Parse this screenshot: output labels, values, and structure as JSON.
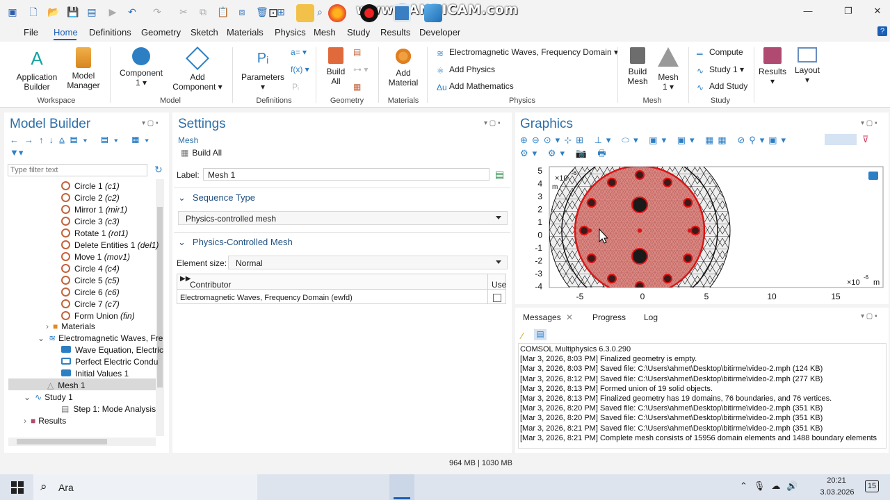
{
  "watermark": "www.BANDICAM.com",
  "menu": {
    "file": "File",
    "home": "Home",
    "definitions": "Definitions",
    "geometry": "Geometry",
    "sketch": "Sketch",
    "materials": "Materials",
    "physics": "Physics",
    "mesh": "Mesh",
    "study": "Study",
    "results": "Results",
    "developer": "Developer"
  },
  "ribbon": {
    "app_builder": [
      "Application",
      "Builder"
    ],
    "model_manager": [
      "Model",
      "Manager"
    ],
    "component": [
      "Component",
      "1 ▾"
    ],
    "add_component": [
      "Add",
      "Component ▾"
    ],
    "parameters": [
      "Parameters",
      "▾"
    ],
    "build_all": [
      "Build",
      "All"
    ],
    "add_material": [
      "Add",
      "Material"
    ],
    "physics_interface": "Electromagnetic Waves, Frequency Domain",
    "add_physics": "Add Physics",
    "add_mathematics": "Add Mathematics",
    "build_mesh": [
      "Build",
      "Mesh"
    ],
    "mesh1": [
      "Mesh",
      "1 ▾"
    ],
    "compute": "Compute",
    "study1": "Study 1",
    "add_study": "Add Study",
    "results": [
      "Results",
      "▾"
    ],
    "layout": [
      "Layout",
      "▾"
    ],
    "groups": {
      "workspace": "Workspace",
      "model": "Model",
      "definitions": "Definitions",
      "geometry": "Geometry",
      "materials": "Materials",
      "physics": "Physics",
      "mesh": "Mesh",
      "study": "Study"
    }
  },
  "model_builder": {
    "title": "Model Builder",
    "filter_placeholder": "Type filter text",
    "items": [
      {
        "label": "Circle 1",
        "tag": "(c1)"
      },
      {
        "label": "Circle 2",
        "tag": "(c2)"
      },
      {
        "label": "Mirror 1",
        "tag": "(mir1)"
      },
      {
        "label": "Circle 3",
        "tag": "(c3)"
      },
      {
        "label": "Rotate 1",
        "tag": "(rot1)"
      },
      {
        "label": "Delete Entities 1",
        "tag": "(del1)"
      },
      {
        "label": "Move 1",
        "tag": "(mov1)"
      },
      {
        "label": "Circle 4",
        "tag": "(c4)"
      },
      {
        "label": "Circle 5",
        "tag": "(c5)"
      },
      {
        "label": "Circle 6",
        "tag": "(c6)"
      },
      {
        "label": "Circle 7",
        "tag": "(c7)"
      },
      {
        "label": "Form Union",
        "tag": "(fin)"
      }
    ],
    "materials": "Materials",
    "emw": "Electromagnetic Waves, Fre",
    "wave_eq": "Wave Equation, Electric",
    "pec": "Perfect Electric Condu",
    "init": "Initial Values 1",
    "mesh1": "Mesh 1",
    "study1": "Study 1",
    "step1": "Step 1: Mode Analysis",
    "results": "Results"
  },
  "settings": {
    "title": "Settings",
    "subtitle": "Mesh",
    "build_all": "Build All",
    "label_caption": "Label:",
    "label_value": "Mesh 1",
    "seq_section": "Sequence Type",
    "seq_value": "Physics-controlled mesh",
    "pcm_section": "Physics-Controlled Mesh",
    "elem_caption": "Element size:",
    "elem_value": "Normal",
    "col_contributor": "Contributor",
    "col_use": "Use",
    "row_contributor": "Electromagnetic Waves, Frequency Domain (ewfd)"
  },
  "graphics": {
    "title": "Graphics",
    "y_ticks": [
      "5",
      "4",
      "3",
      "2",
      "1",
      "0",
      "-1",
      "-2",
      "-3",
      "-4"
    ],
    "x_ticks": [
      "-5",
      "0",
      "5",
      "10",
      "15"
    ],
    "y_exp": "×10",
    "y_exp_pow": "-6",
    "y_unit": "m",
    "x_exp": "×10",
    "x_exp_pow": "-6",
    "x_unit": "m"
  },
  "messages": {
    "tabs": [
      "Messages",
      "Progress",
      "Log"
    ],
    "lines": [
      "COMSOL Multiphysics 6.3.0.290",
      "[Mar 3, 2026, 8:03 PM] Finalized geometry is empty.",
      "[Mar 3, 2026, 8:03 PM] Saved file: C:\\Users\\ahmet\\Desktop\\bitirme\\video-2.mph (124 KB)",
      "[Mar 3, 2026, 8:12 PM] Saved file: C:\\Users\\ahmet\\Desktop\\bitirme\\video-2.mph (277 KB)",
      "[Mar 3, 2026, 8:13 PM] Formed union of 19 solid objects.",
      "[Mar 3, 2026, 8:13 PM] Finalized geometry has 19 domains, 76 boundaries, and 76 vertices.",
      "[Mar 3, 2026, 8:20 PM] Saved file: C:\\Users\\ahmet\\Desktop\\bitirme\\video-2.mph (351 KB)",
      "[Mar 3, 2026, 8:20 PM] Saved file: C:\\Users\\ahmet\\Desktop\\bitirme\\video-2.mph (351 KB)",
      "[Mar 3, 2026, 8:21 PM] Saved file: C:\\Users\\ahmet\\Desktop\\bitirme\\video-2.mph (351 KB)",
      "[Mar 3, 2026, 8:21 PM] Complete mesh consists of 15956 domain elements and 1488 boundary elements"
    ]
  },
  "status": {
    "memory": "964 MB | 1030 MB"
  },
  "taskbar": {
    "search": "Ara",
    "time": "20:21",
    "date": "3.03.2026",
    "notif": "15"
  },
  "colors": {
    "accent": "#1a5fb4",
    "title": "#2d6fa8",
    "mesh_fill": "#d98882",
    "mesh_edge": "#d11",
    "strand": "#1a1a1a"
  }
}
